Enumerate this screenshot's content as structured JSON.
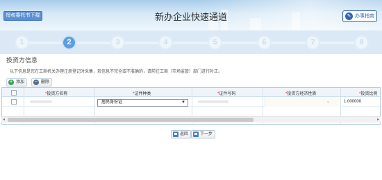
{
  "header": {
    "download_label": "授权委托书下载",
    "title": "新办企业快速通道",
    "guide_label": "办事指南"
  },
  "steps": [
    "1",
    "2",
    "3",
    "4",
    "5",
    "6",
    "7",
    "8"
  ],
  "active_step": 2,
  "section": {
    "title": "投资方信息",
    "notice": "以下信息是您在工商机关办理注册登记时采集，若信息不完全或不准确的，请前往工商（市场监管）部门进行补正。"
  },
  "toolbar": {
    "add_label": "添加",
    "delete_label": "删除"
  },
  "grid": {
    "required_mark": "*",
    "columns": [
      "投资方名称",
      "证件种类",
      "证件号码",
      "投资方经济性质",
      "投资比例"
    ],
    "rows": [
      {
        "name": "",
        "id_type": "居民身份证",
        "id_number": "",
        "nature": "",
        "ratio": "1.000000"
      }
    ]
  },
  "actions": {
    "back_label": "返回",
    "next_label": "下一步"
  },
  "colors": {
    "accent": "#5b9ee6",
    "brand_blue": "#2f66b3",
    "required": "#e02020"
  }
}
